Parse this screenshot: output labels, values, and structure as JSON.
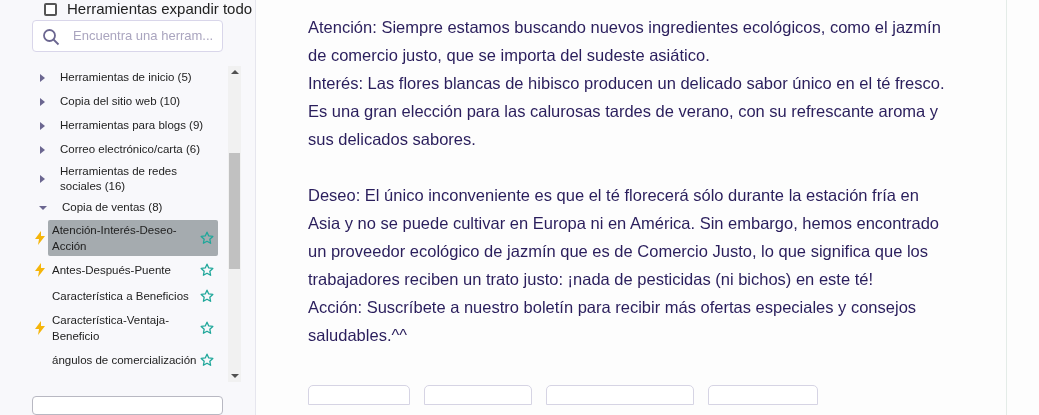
{
  "header": {
    "label": "Herramientas expandir todo",
    "checked": false
  },
  "search": {
    "placeholder": "Encuentra una herram..."
  },
  "tree": [
    {
      "label": "Herramientas de inicio (5)",
      "expanded": false
    },
    {
      "label": "Copia del sitio web (10)",
      "expanded": false
    },
    {
      "label": "Herramientas para blogs (9)",
      "expanded": false
    },
    {
      "label": "Correo electrónico/carta (6)",
      "expanded": false
    },
    {
      "label": "Herramientas de redes sociales (16)",
      "expanded": false
    },
    {
      "label": "Copia de ventas (8)",
      "expanded": true,
      "children": [
        {
          "label": "Atención-Interés-Deseo-Acción",
          "selected": true,
          "boosted": true
        },
        {
          "label": "Antes-Después-Puente",
          "selected": false,
          "boosted": true
        },
        {
          "label": "Característica a Beneficios",
          "selected": false,
          "boosted": false
        },
        {
          "label": "Característica-Ventaja-Beneficio",
          "selected": false,
          "boosted": true
        },
        {
          "label": "ángulos de comercialización",
          "selected": false,
          "boosted": false
        }
      ]
    }
  ],
  "content": {
    "blocks": [
      [
        "Atención: Siempre estamos buscando nuevos ingredientes ecológicos, como el jazmín de comercio justo, que se importa del sudeste asiático.",
        "Interés: Las flores blancas de hibisco producen un delicado sabor único en el té fresco. Es una gran elección para las calurosas tardes de verano, con su refrescante aroma y sus delicados sabores."
      ],
      [
        "Deseo: El único inconveniente es que el té florecerá sólo durante la estación fría en Asia y no se puede cultivar en Europa ni en América. Sin embargo, hemos encontrado un proveedor ecológico de jazmín que es de Comercio Justo, lo que significa que los trabajadores reciben un trato justo: ¡nada de pesticidas (ni bichos) en este té!",
        "Acción: Suscríbete a nuestro boletín para recibir más ofertas especiales y consejos saludables.^^"
      ]
    ]
  }
}
